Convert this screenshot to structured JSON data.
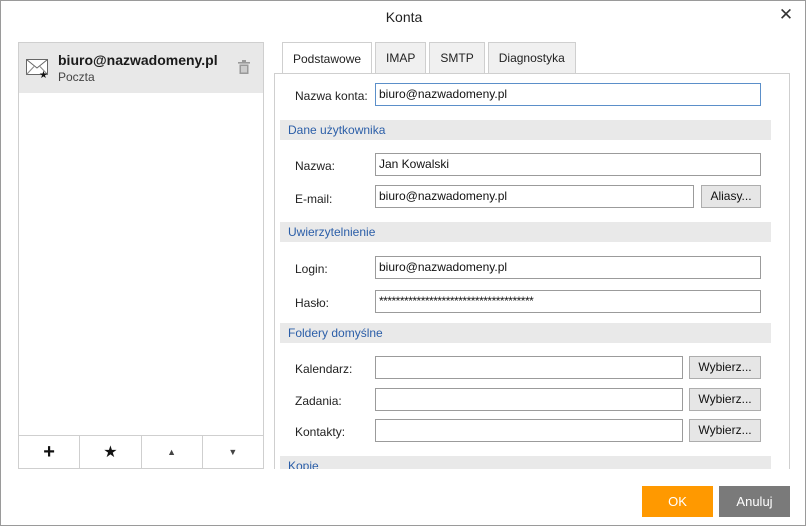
{
  "dialog": {
    "title": "Konta",
    "close_glyph": "✕"
  },
  "accounts": {
    "items": [
      {
        "email": "biuro@nazwadomeny.pl",
        "type": "Poczta",
        "icon": "envelope-icon",
        "default_badge": "★"
      }
    ],
    "toolbar": {
      "add": "+",
      "default": "★",
      "up": "▲",
      "down": "▼"
    }
  },
  "tabs": [
    {
      "label": "Podstawowe",
      "active": true
    },
    {
      "label": "IMAP",
      "active": false
    },
    {
      "label": "SMTP",
      "active": false
    },
    {
      "label": "Diagnostyka",
      "active": false
    }
  ],
  "form": {
    "account_name": {
      "label": "Nazwa konta:",
      "value": "biuro@nazwadomeny.pl"
    },
    "user_section": "Dane użytkownika",
    "name": {
      "label": "Nazwa:",
      "value": "Jan Kowalski"
    },
    "email": {
      "label": "E-mail:",
      "value": "biuro@nazwadomeny.pl",
      "button": "Aliasy..."
    },
    "auth_section": "Uwierzytelnienie",
    "login": {
      "label": "Login:",
      "value": "biuro@nazwadomeny.pl"
    },
    "password": {
      "label": "Hasło:",
      "value": "*************************************"
    },
    "folders_section": "Foldery domyślne",
    "calendar": {
      "label": "Kalendarz:",
      "value": "",
      "button": "Wybierz..."
    },
    "tasks": {
      "label": "Zadania:",
      "value": "",
      "button": "Wybierz..."
    },
    "contacts": {
      "label": "Kontakty:",
      "value": "",
      "button": "Wybierz..."
    },
    "copies_section": "Kopie"
  },
  "footer": {
    "ok": "OK",
    "cancel": "Anuluj"
  },
  "colors": {
    "accent": "#ff9900",
    "cancel_bg": "#7a7a7a",
    "section_text": "#2b5ea8",
    "section_bg": "#e9e9e9"
  }
}
